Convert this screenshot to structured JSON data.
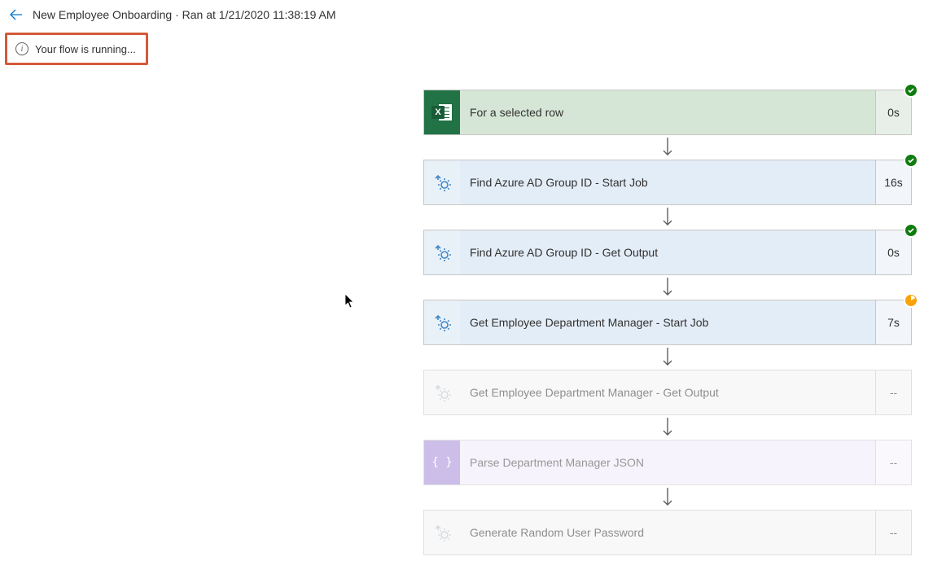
{
  "header": {
    "title": "New Employee Onboarding · Ran at 1/21/2020 11:38:19 AM"
  },
  "status": {
    "message": "Your flow is running..."
  },
  "steps": [
    {
      "label": "For a selected row",
      "duration": "0s",
      "kind": "excel",
      "status": "success",
      "disabled": false
    },
    {
      "label": "Find Azure AD Group ID - Start Job",
      "duration": "16s",
      "kind": "automation",
      "status": "success",
      "disabled": false
    },
    {
      "label": "Find Azure AD Group ID - Get Output",
      "duration": "0s",
      "kind": "automation",
      "status": "success",
      "disabled": false
    },
    {
      "label": "Get Employee Department Manager - Start Job",
      "duration": "7s",
      "kind": "automation",
      "status": "running",
      "disabled": false
    },
    {
      "label": "Get Employee Department Manager - Get Output",
      "duration": "--",
      "kind": "automation",
      "status": "none",
      "disabled": true
    },
    {
      "label": "Parse Department Manager JSON",
      "duration": "--",
      "kind": "json",
      "status": "none",
      "disabled": true
    },
    {
      "label": "Generate Random User Password",
      "duration": "--",
      "kind": "automation",
      "status": "none",
      "disabled": true
    }
  ]
}
